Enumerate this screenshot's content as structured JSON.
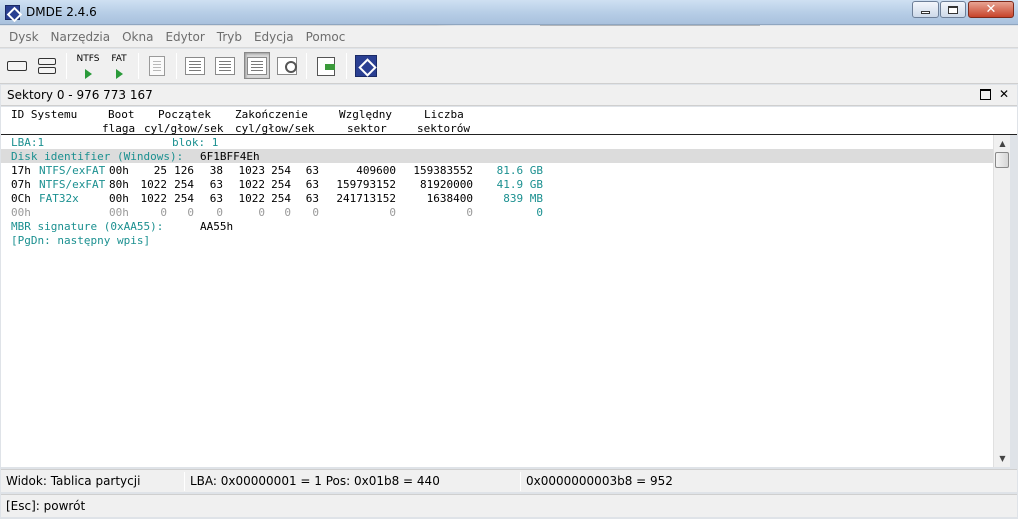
{
  "window": {
    "title": "DMDE 2.4.6"
  },
  "menu": {
    "items": [
      "Dysk",
      "Narzędzia",
      "Okna",
      "Edytor",
      "Tryb",
      "Edycja",
      "Pomoc"
    ]
  },
  "toolbar": {
    "ntfs_label": "NTFS",
    "fat_label": "FAT",
    "buttons": [
      "disk-icon",
      "disks-icon",
      "ntfs-scan-icon",
      "fat-scan-icon",
      "new-document-icon",
      "directory-view-icon",
      "list-view-icon",
      "partition-table-icon",
      "find-icon",
      "export-icon",
      "dmde-logo-icon"
    ]
  },
  "panel": {
    "title": "Sektory 0 - 976 773 167",
    "restore_glyph": "",
    "close_glyph": "✕"
  },
  "columns": {
    "line1": [
      "ID Systemu",
      "Boot",
      "Początek",
      "Zakończenie",
      "Względny",
      "Liczba"
    ],
    "line2": [
      "flaga",
      "cyl/głow/sek",
      "cyl/głow/sek",
      "sektor",
      "sektorów"
    ]
  },
  "rows": {
    "lba": "LBA:1",
    "blok": "blok: 1",
    "disk_id_label": "Disk identifier (Windows):",
    "disk_id_value": "6F1BFF4Eh",
    "partitions": [
      {
        "id": "17h",
        "system": "NTFS/exFAT",
        "boot": "00h",
        "s_cyl": "25",
        "s_head": "126",
        "s_sec": "38",
        "e_cyl": "1023",
        "e_head": "254",
        "e_sec": "63",
        "rel": "409600",
        "count": "159383552",
        "size": "81.6 GB"
      },
      {
        "id": "07h",
        "system": "NTFS/exFAT",
        "boot": "80h",
        "s_cyl": "1022",
        "s_head": "254",
        "s_sec": "63",
        "e_cyl": "1022",
        "e_head": "254",
        "e_sec": "63",
        "rel": "159793152",
        "count": "81920000",
        "size": "41.9 GB"
      },
      {
        "id": "0Ch",
        "system": "FAT32x",
        "boot": "00h",
        "s_cyl": "1022",
        "s_head": "254",
        "s_sec": "63",
        "e_cyl": "1022",
        "e_head": "254",
        "e_sec": "63",
        "rel": "241713152",
        "count": "1638400",
        "size": "839 MB"
      },
      {
        "id": "00h",
        "system": "",
        "boot": "00h",
        "s_cyl": "0",
        "s_head": "0",
        "s_sec": "0",
        "e_cyl": "0",
        "e_head": "0",
        "e_sec": "0",
        "rel": "0",
        "count": "0",
        "size": "0"
      }
    ],
    "mbr_label": "MBR signature (0xAA55):",
    "mbr_value": "AA55h",
    "pgdn": "[PgDn: następny wpis]"
  },
  "status": {
    "view": "Widok: Tablica partycji",
    "lba_pos": "LBA: 0x00000001 = 1  Pos: 0x01b8 = 440",
    "offset": "0x0000000003b8 = 952",
    "esc": "[Esc]: powrót"
  },
  "colors": {
    "accent_teal": "#1b9090",
    "highlight": "#dcdcdc"
  }
}
